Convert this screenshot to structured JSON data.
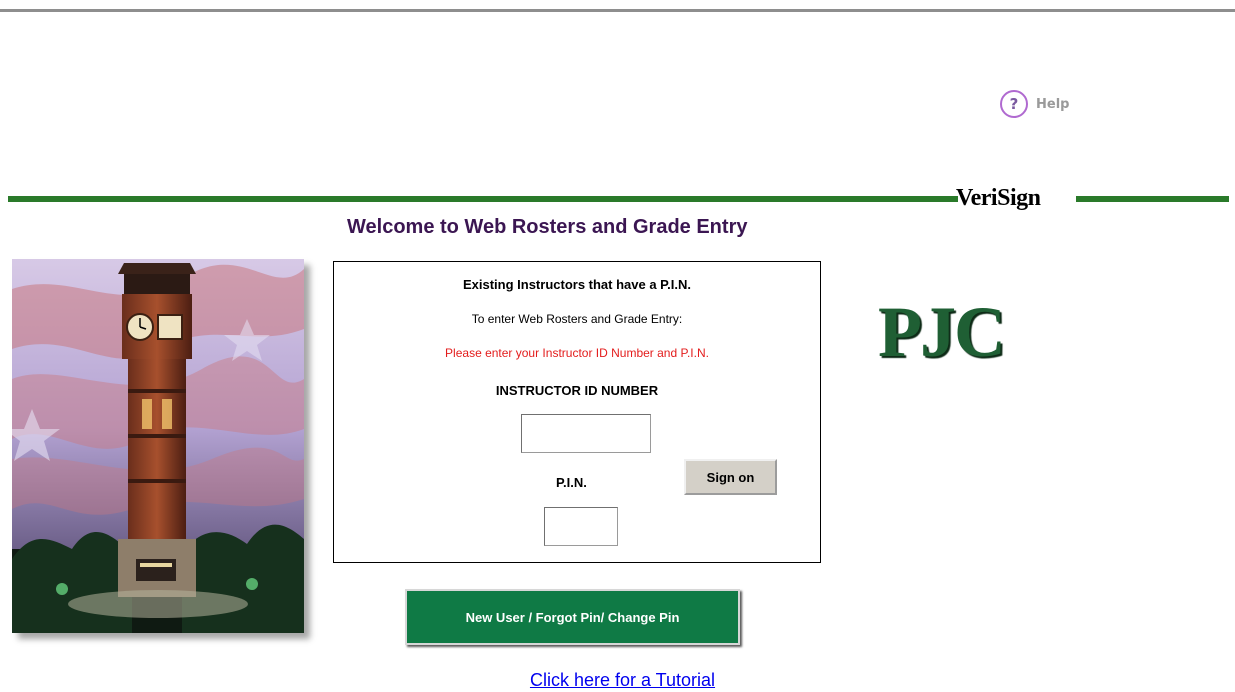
{
  "help": {
    "icon_glyph": "?",
    "label": "Help",
    "icon": "help-icon"
  },
  "verisign": {
    "logo_text": "VeriSign"
  },
  "welcome": "Welcome to Web Rosters and Grade Entry",
  "login": {
    "heading": "Existing Instructors that have a P.I.N.",
    "subheading": "To enter Web Rosters and Grade Entry:",
    "instruction": "Please enter your Instructor ID Number  and P.I.N.",
    "id_label": "INSTRUCTOR ID NUMBER",
    "id_value": "",
    "pin_label": "P.I.N.",
    "pin_value": "",
    "signon_label": "Sign on"
  },
  "logo": {
    "text": "PJC"
  },
  "new_user_label": "New User / Forgot Pin/ Change Pin",
  "tutorial_link": "Click here for a Tutorial",
  "colors": {
    "accent_green": "#2a7a2a",
    "button_green": "#0f7a45",
    "welcome_purple": "#3b1652",
    "warning_red": "#e31c1c",
    "link_blue": "#0000ee",
    "help_purple": "#b06ad0"
  }
}
